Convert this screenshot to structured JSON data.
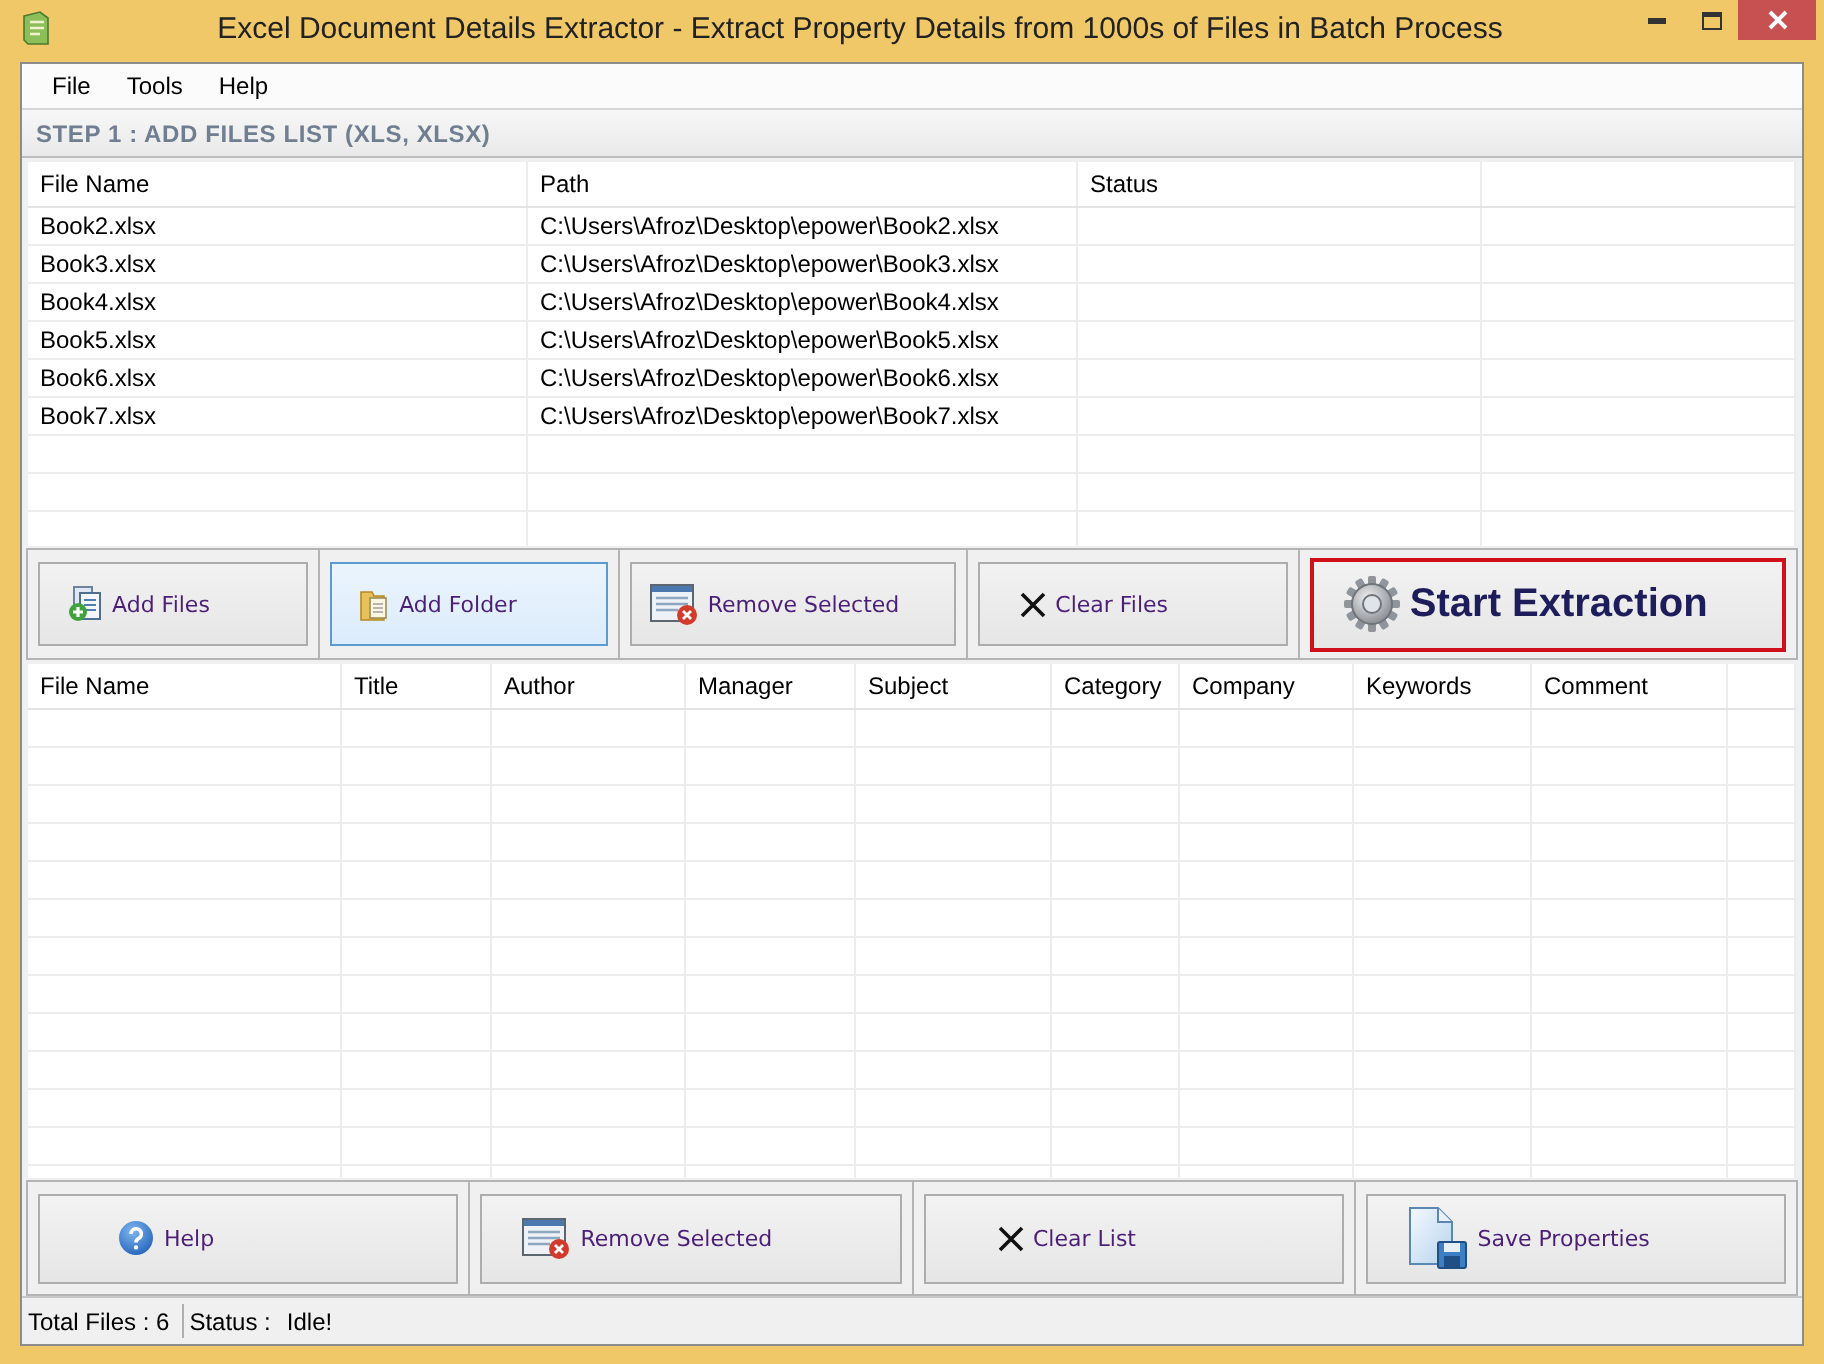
{
  "window": {
    "title": "Excel Document Details Extractor - Extract Property Details from 1000s of Files in Batch Process"
  },
  "menu": [
    "File",
    "Tools",
    "Help"
  ],
  "step_header": "STEP 1 : ADD FILES LIST (XLS, XLSX)",
  "files_table": {
    "columns": [
      "File Name",
      "Path",
      "Status"
    ],
    "rows": [
      {
        "file_name": "Book2.xlsx",
        "path": "C:\\Users\\Afroz\\Desktop\\epower\\Book2.xlsx"
      },
      {
        "file_name": "Book3.xlsx",
        "path": "C:\\Users\\Afroz\\Desktop\\epower\\Book3.xlsx"
      },
      {
        "file_name": "Book4.xlsx",
        "path": "C:\\Users\\Afroz\\Desktop\\epower\\Book4.xlsx"
      },
      {
        "file_name": "Book5.xlsx",
        "path": "C:\\Users\\Afroz\\Desktop\\epower\\Book5.xlsx"
      },
      {
        "file_name": "Book6.xlsx",
        "path": "C:\\Users\\Afroz\\Desktop\\epower\\Book6.xlsx"
      },
      {
        "file_name": "Book7.xlsx",
        "path": "C:\\Users\\Afroz\\Desktop\\epower\\Book7.xlsx"
      }
    ]
  },
  "file_buttons": [
    {
      "kind": "add",
      "label": "Add Files",
      "focused": false
    },
    {
      "kind": "folder",
      "label": "Add Folder",
      "focused": true
    },
    {
      "kind": "remove",
      "label": "Remove Selected",
      "focused": false
    },
    {
      "kind": "clear",
      "label": "Clear Files",
      "focused": false
    },
    {
      "kind": "start",
      "label": "Start Extraction",
      "focused": false
    }
  ],
  "properties_table": {
    "columns": [
      "File Name",
      "Title",
      "Author",
      "Manager",
      "Subject",
      "Category",
      "Company",
      "Keywords",
      "Comment"
    ]
  },
  "action_buttons": [
    {
      "kind": "help",
      "label": "Help"
    },
    {
      "kind": "remove",
      "label": "Remove Selected"
    },
    {
      "kind": "clear",
      "label": "Clear List"
    },
    {
      "kind": "save",
      "label": "Save Properties"
    }
  ],
  "status_bar": {
    "total_files": "Total Files : 6",
    "status_label": "Status :",
    "status_value": "Idle!"
  }
}
